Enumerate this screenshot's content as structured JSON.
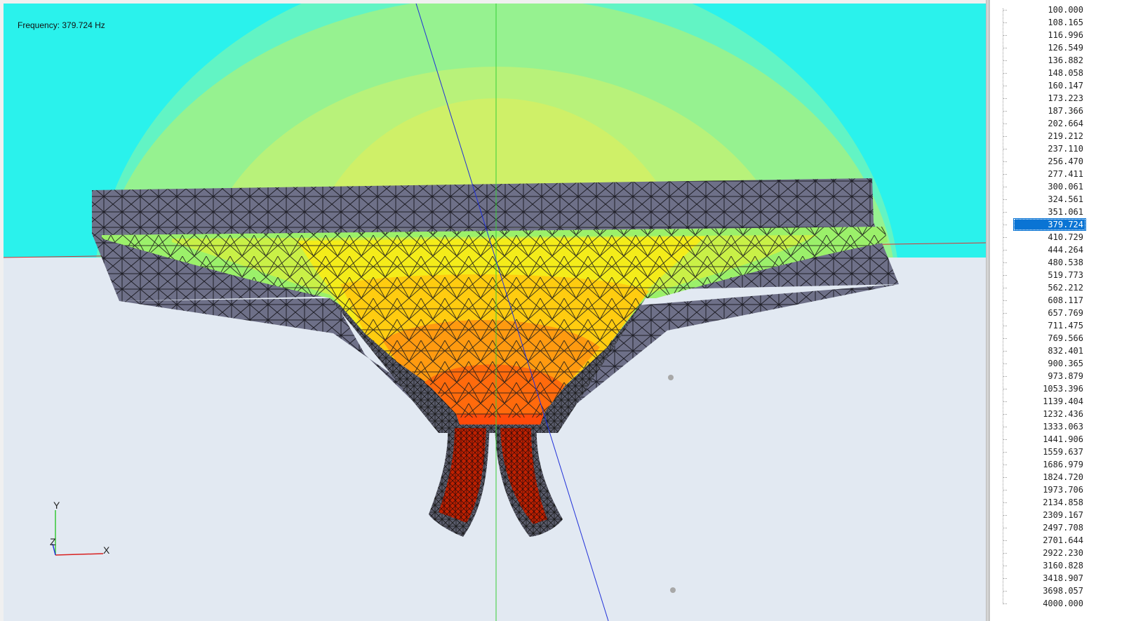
{
  "viewport": {
    "frequency_label": "Frequency: 379.724 Hz",
    "axis_labels": {
      "y": "Y",
      "z": "Z",
      "x": "X"
    },
    "colors": {
      "background": "#e2e9f2",
      "field_outer": "#2af2ec",
      "field_1": "#62f4c4",
      "field_2": "#96f290",
      "field_3": "#cff068",
      "mesh_gray": "#6e7088",
      "mesh_hot": "#ff5a10",
      "mesh_core": "#e12a00"
    }
  },
  "frequency_list": {
    "selected_index": 17,
    "items": [
      "100.000",
      "108.165",
      "116.996",
      "126.549",
      "136.882",
      "148.058",
      "160.147",
      "173.223",
      "187.366",
      "202.664",
      "219.212",
      "237.110",
      "256.470",
      "277.411",
      "300.061",
      "324.561",
      "351.061",
      "379.724",
      "410.729",
      "444.264",
      "480.538",
      "519.773",
      "562.212",
      "608.117",
      "657.769",
      "711.475",
      "769.566",
      "832.401",
      "900.365",
      "973.879",
      "1053.396",
      "1139.404",
      "1232.436",
      "1333.063",
      "1441.906",
      "1559.637",
      "1686.979",
      "1824.720",
      "1973.706",
      "2134.858",
      "2309.167",
      "2497.708",
      "2701.644",
      "2922.230",
      "3160.828",
      "3418.907",
      "3698.057",
      "4000.000"
    ]
  }
}
